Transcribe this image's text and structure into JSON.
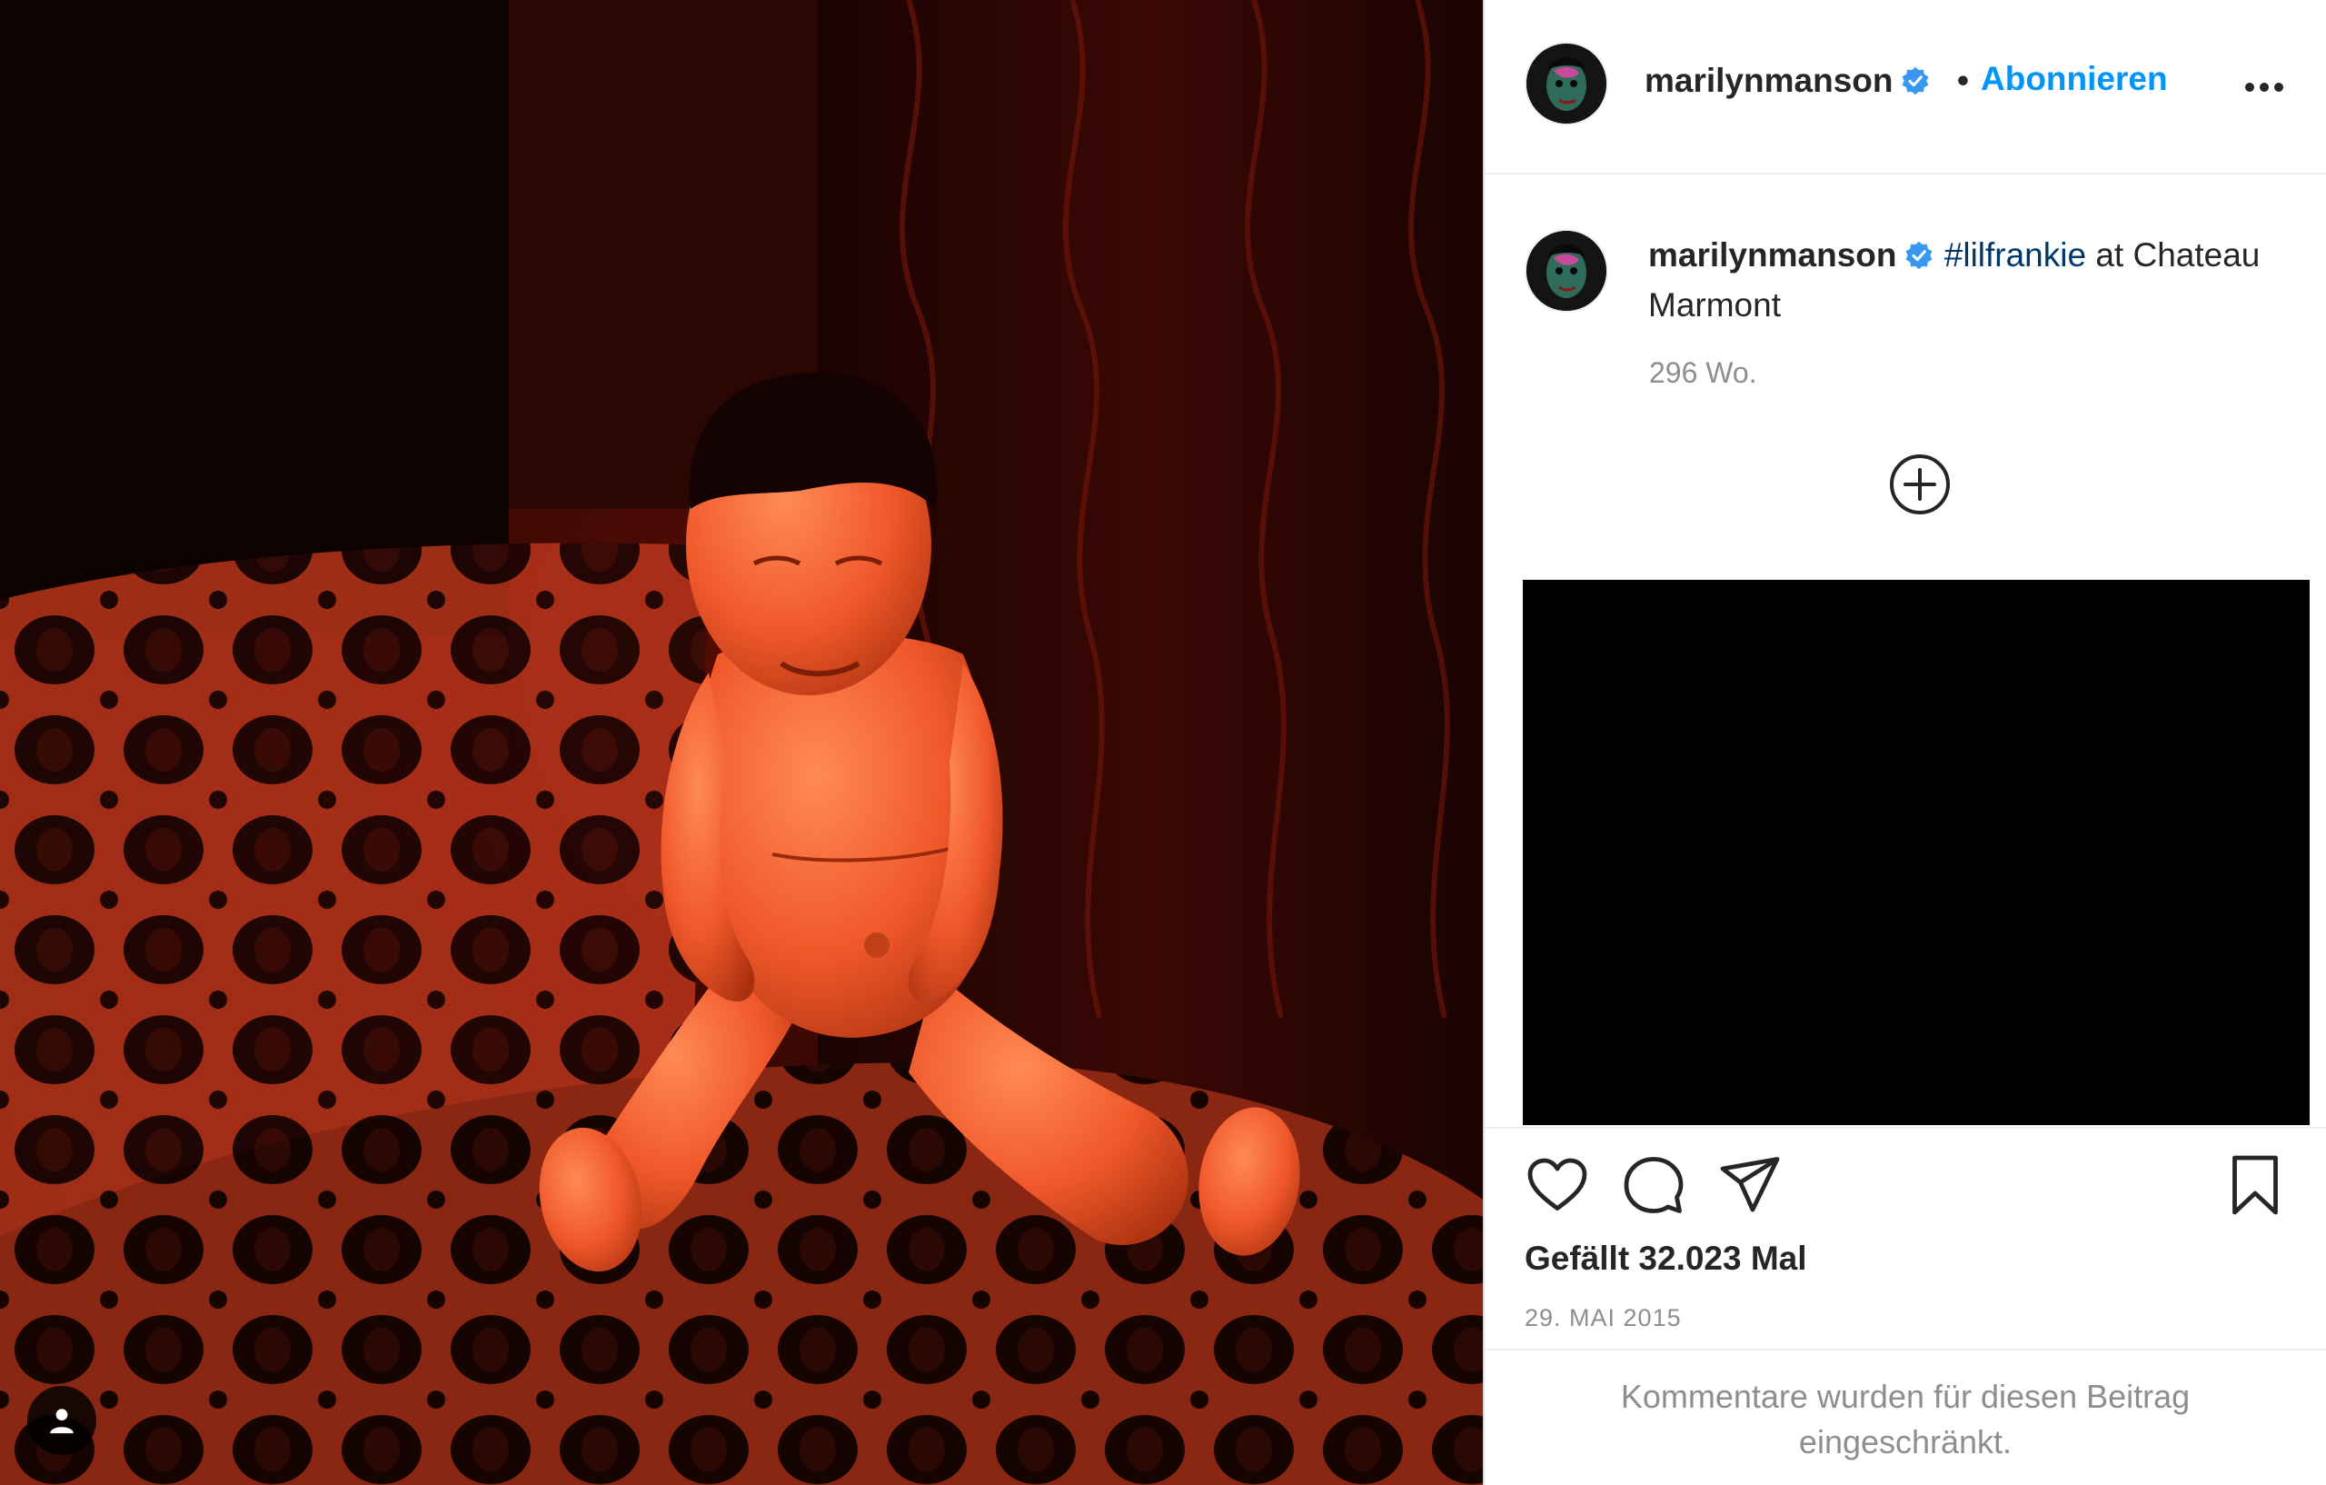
{
  "post": {
    "username": "marilynmanson",
    "separator": "•",
    "follow_label": "Abonnieren",
    "caption": {
      "username": "marilynmanson",
      "hashtag": "#lilfrankie",
      "text": " at Chateau Marmont",
      "time_ago": "296 Wo."
    },
    "likes_text": "Gefällt 32.023 Mal",
    "date": "29. MAI 2015",
    "comments_restricted": "Kommentare wurden für diesen Beitrag eingeschränkt."
  },
  "icons": {
    "verified": "verified-badge-icon",
    "more": "more-options-icon",
    "load_more": "plus-circle-icon",
    "like": "heart-icon",
    "comment": "comment-icon",
    "share": "paper-plane-icon",
    "save": "bookmark-icon",
    "tags": "user-tag-icon"
  },
  "colors": {
    "accent": "#0095f6",
    "verified": "#3897f0",
    "hashtag": "#00376b",
    "muted": "#8e8e8e",
    "text": "#262626"
  }
}
